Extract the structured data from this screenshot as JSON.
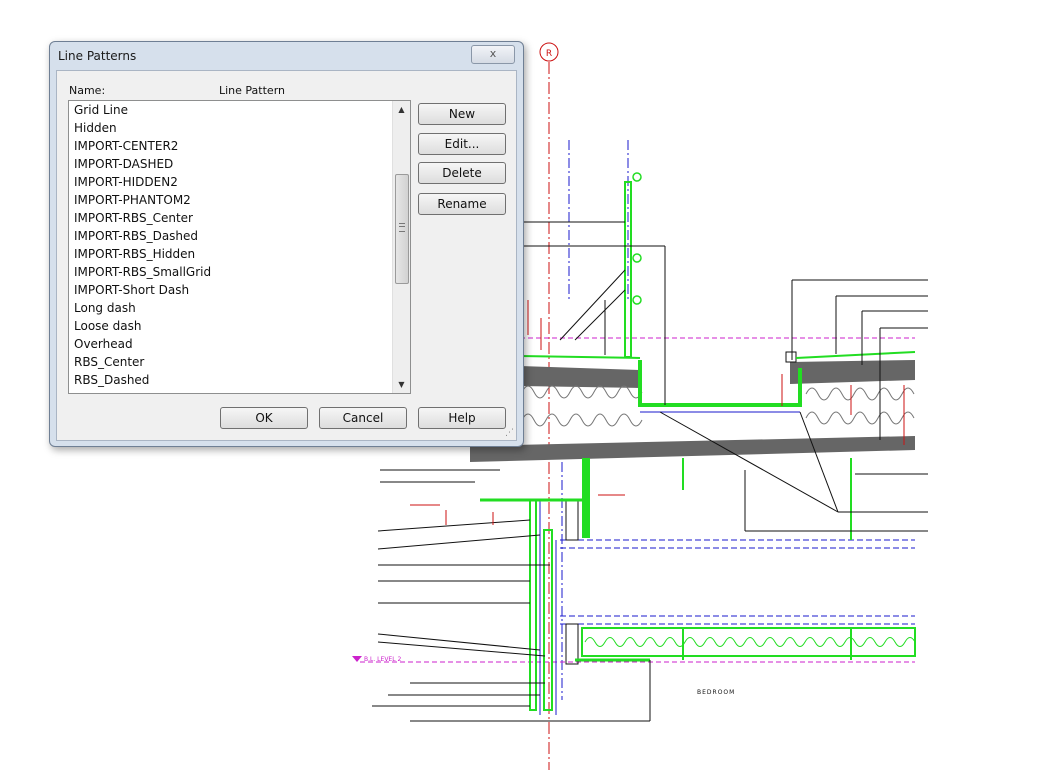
{
  "dialog": {
    "title": "Line Patterns",
    "close_glyph": "x",
    "col_name": "Name:",
    "col_pattern": "Line Pattern",
    "patterns": [
      {
        "name": "Grid Line",
        "pattern": "-.-"
      },
      {
        "name": "Hidden",
        "pattern": "dash-fine"
      },
      {
        "name": "IMPORT-CENTER2",
        "pattern": "solid"
      },
      {
        "name": "IMPORT-DASHED",
        "pattern": "solid"
      },
      {
        "name": "IMPORT-HIDDEN2",
        "pattern": "solid"
      },
      {
        "name": "IMPORT-PHANTOM2",
        "pattern": "solid"
      },
      {
        "name": "IMPORT-RBS_Center",
        "pattern": "-.-"
      },
      {
        "name": "IMPORT-RBS_Dashed",
        "pattern": "dash-fine"
      },
      {
        "name": "IMPORT-RBS_Hidden",
        "pattern": "dash-fine"
      },
      {
        "name": "IMPORT-RBS_SmallGrid",
        "pattern": "dot"
      },
      {
        "name": "IMPORT-Short Dash",
        "pattern": "dash-short"
      },
      {
        "name": "Long dash",
        "pattern": "dash-long"
      },
      {
        "name": "Loose dash",
        "pattern": "dash-loose"
      },
      {
        "name": "Overhead",
        "pattern": "dash-fine"
      },
      {
        "name": "RBS_Center",
        "pattern": "-.-"
      },
      {
        "name": "RBS_Dashed",
        "pattern": "dash-fine"
      }
    ],
    "buttons": {
      "new": "New",
      "edit": "Edit...",
      "delete": "Delete",
      "rename": "Rename",
      "ok": "OK",
      "cancel": "Cancel",
      "help": "Help"
    }
  },
  "drawing": {
    "grid_bubble": "R",
    "level_label": "B.L. LEVEL 2",
    "room_label": "BEDROOM",
    "colors": {
      "green": "#22dd22",
      "blue": "#1a1acc",
      "magenta": "#cc22cc",
      "red": "#cc1111",
      "slab": "#666666",
      "annot": "#111111"
    }
  }
}
